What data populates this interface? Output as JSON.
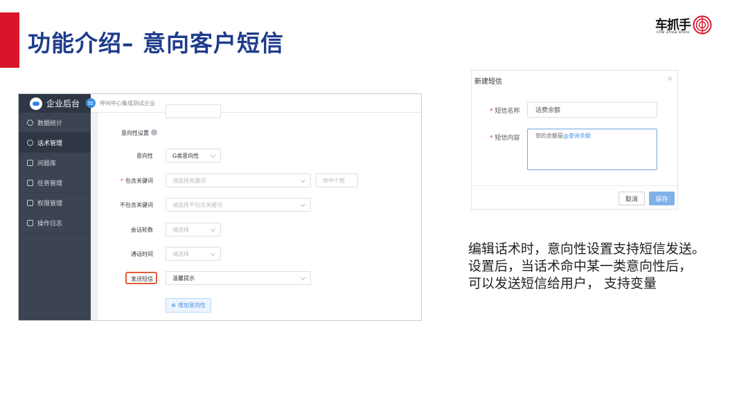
{
  "slide": {
    "title": "功能介绍– 意向客户短信",
    "logo_text": "车抓手",
    "logo_sub": "che zhua shou",
    "accent_color": "#d9152a",
    "title_color": "#1e3c8c"
  },
  "admin": {
    "brand": "企业后台",
    "breadcrumb": "呼叫中心集成测试企业",
    "sidebar": {
      "items": [
        {
          "label": "数据统计",
          "icon": "clock-icon"
        },
        {
          "label": "话术管理",
          "icon": "chat-icon"
        },
        {
          "label": "问题库",
          "icon": "book-icon"
        },
        {
          "label": "任务管理",
          "icon": "grid-icon"
        },
        {
          "label": "权限管理",
          "icon": "layers-icon"
        },
        {
          "label": "操作日志",
          "icon": "log-icon"
        }
      ],
      "active_item": "话术管理"
    },
    "form": {
      "section_title": "意向性设置",
      "intent_label": "意向性",
      "intent_value": "G类意向性",
      "include_keywords_label": "包含关键词",
      "include_keywords_placeholder": "请选择关键词",
      "hit_count_placeholder": "命中个数",
      "exclude_keywords_label": "不包含关键词",
      "exclude_keywords_placeholder": "请选择不包含关键词",
      "rounds_label": "会话轮数",
      "rounds_placeholder": "请选择",
      "duration_label": "通话时间",
      "duration_placeholder": "请选择",
      "send_sms_label": "发送短信",
      "send_sms_value": "温馨提示",
      "add_intent_button": "增加意向性"
    }
  },
  "dialog": {
    "title": "新建短信",
    "close": "×",
    "name_label": "短信名称",
    "name_value": "话费余额",
    "content_label": "短信内容",
    "content_text": "您的余额是",
    "content_variable": "@查询余额",
    "cancel_button": "取消",
    "save_button": "保存"
  },
  "description": {
    "lines": [
      "编辑话术时，意向性设置支持短信发送。",
      "设置后，当话术命中某一类意向性后，",
      "可以发送短信给用户， 支持变量"
    ]
  }
}
